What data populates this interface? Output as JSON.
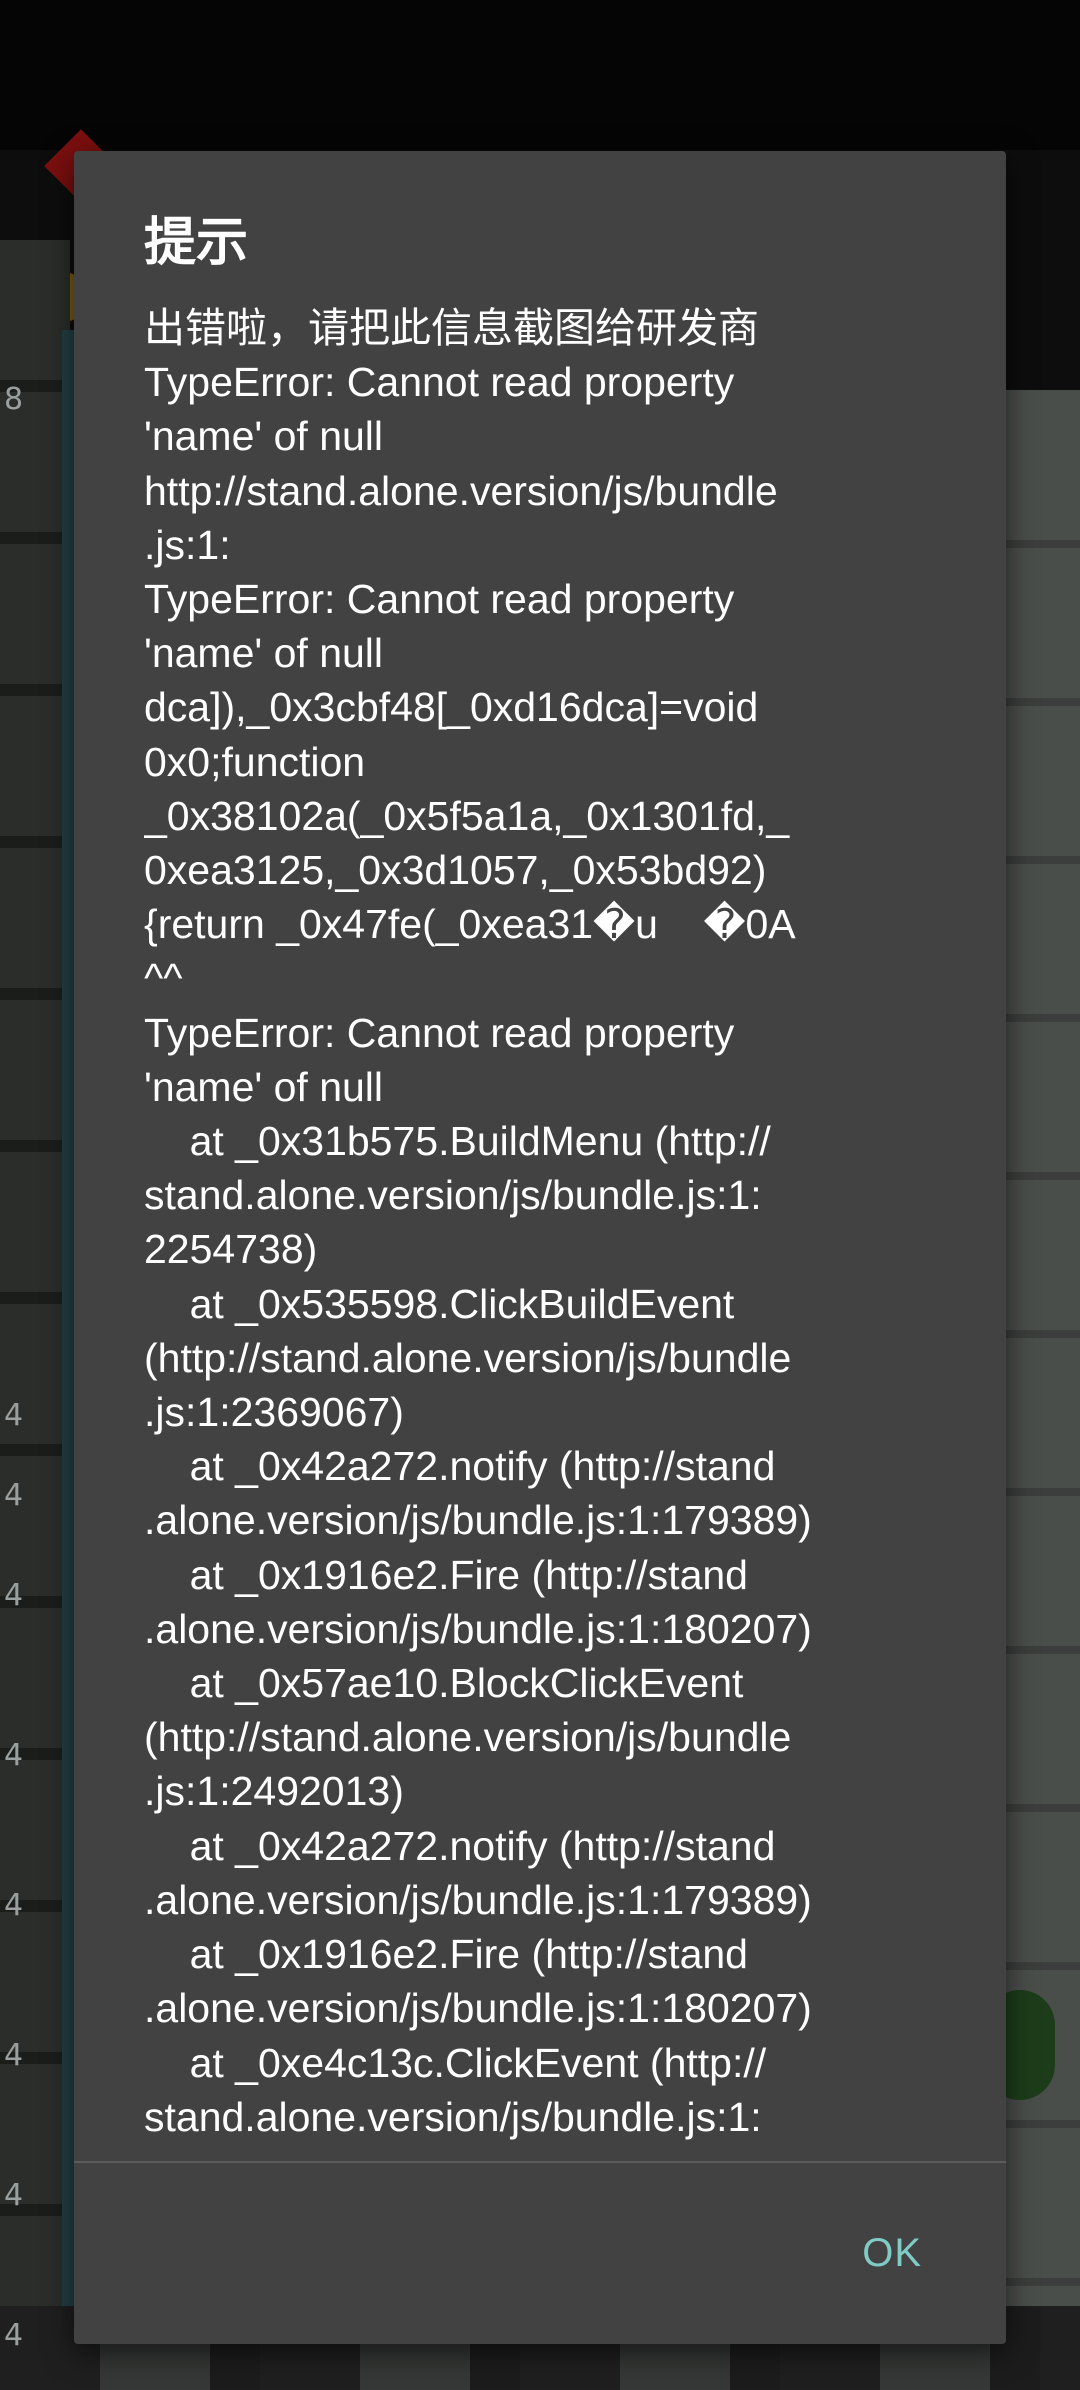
{
  "background": {
    "number_left": "8",
    "row_numbers": [
      "4",
      "4",
      "4",
      "4",
      "4",
      "4",
      "4",
      "4"
    ]
  },
  "dialog": {
    "title": "提示",
    "message_lines": [
      "出错啦，请把此信息截图给研发商",
      "TypeError: Cannot read property",
      "'name' of null",
      "http://stand.alone.version/js/bundle",
      ".js:1:",
      "TypeError: Cannot read property",
      "'name' of null",
      "dca]),_0x3cbf48[_0xd16dca]=void",
      "0x0;function",
      "_0x38102a(_0x5f5a1a,_0x1301fd,_",
      "0xea3125,_0x3d1057,_0x53bd92)",
      "{return _0x47fe(_0xea31�u    �0A",
      "^^",
      "TypeError: Cannot read property",
      "'name' of null",
      "    at _0x31b575.BuildMenu (http://",
      "stand.alone.version/js/bundle.js:1:",
      "2254738)",
      "    at _0x535598.ClickBuildEvent",
      "(http://stand.alone.version/js/bundle",
      ".js:1:2369067)",
      "    at _0x42a272.notify (http://stand",
      ".alone.version/js/bundle.js:1:179389)",
      "    at _0x1916e2.Fire (http://stand",
      ".alone.version/js/bundle.js:1:180207)",
      "    at _0x57ae10.BlockClickEvent",
      "(http://stand.alone.version/js/bundle",
      ".js:1:2492013)",
      "    at _0x42a272.notify (http://stand",
      ".alone.version/js/bundle.js:1:179389)",
      "    at _0x1916e2.Fire (http://stand",
      ".alone.version/js/bundle.js:1:180207)",
      "    at _0xe4c13c.ClickEvent (http://",
      "stand.alone.version/js/bundle.js:1:"
    ],
    "ok_label": "OK"
  },
  "colors": {
    "dialog_bg": "#424242",
    "accent": "#80cbc4",
    "text": "#ffffff"
  }
}
